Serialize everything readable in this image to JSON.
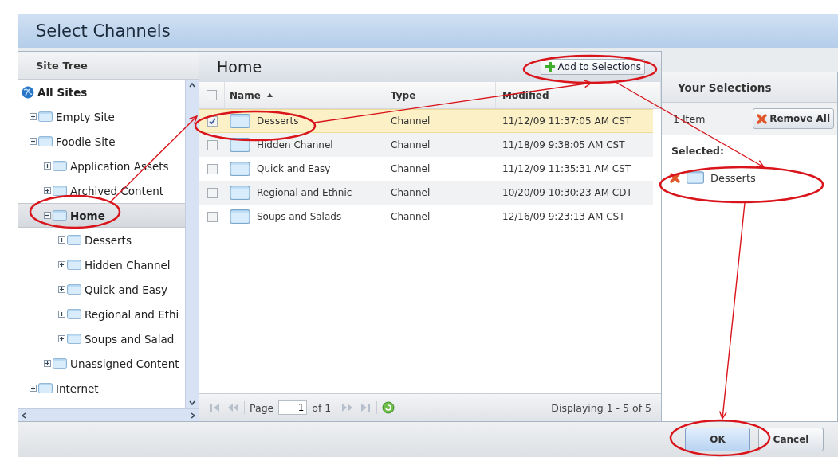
{
  "window": {
    "title": "Select Channels"
  },
  "site_tree": {
    "title": "Site Tree",
    "items": [
      {
        "label": "All Sites",
        "kind": "root",
        "selected": false,
        "children": [
          {
            "label": "Empty Site",
            "kind": "folder",
            "expanded": false,
            "selected": false
          },
          {
            "label": "Foodie Site",
            "kind": "folder",
            "expanded": true,
            "selected": false,
            "children": [
              {
                "label": "Application Assets",
                "kind": "folder",
                "expanded": false,
                "selected": false
              },
              {
                "label": "Archived Content",
                "kind": "folder",
                "expanded": false,
                "selected": false
              },
              {
                "label": "Home",
                "kind": "folder",
                "expanded": true,
                "selected": true,
                "children": [
                  {
                    "label": "Desserts",
                    "kind": "folder",
                    "expanded": false,
                    "selected": false
                  },
                  {
                    "label": "Hidden Channel",
                    "kind": "folder",
                    "expanded": false,
                    "selected": false
                  },
                  {
                    "label": "Quick and Easy",
                    "kind": "folder",
                    "expanded": false,
                    "selected": false
                  },
                  {
                    "label": "Regional and Ethi",
                    "kind": "folder",
                    "expanded": false,
                    "selected": false
                  },
                  {
                    "label": "Soups and Salad",
                    "kind": "folder",
                    "expanded": false,
                    "selected": false
                  }
                ]
              },
              {
                "label": "Unassigned Content",
                "kind": "folder",
                "expanded": false,
                "selected": false
              }
            ]
          },
          {
            "label": "Internet",
            "kind": "folder",
            "expanded": false,
            "selected": false
          }
        ]
      }
    ]
  },
  "channel_list": {
    "title": "Home",
    "add_button": "Add to Selections",
    "columns": [
      "Name",
      "Type",
      "Modified"
    ],
    "all_checked": false,
    "rows": [
      {
        "name": "Desserts",
        "type": "Channel",
        "modified": "11/12/09 11:37:05 AM CST",
        "checked": true,
        "selected": true
      },
      {
        "name": "Hidden Channel",
        "type": "Channel",
        "modified": "11/18/09 9:38:05 AM CST",
        "checked": false,
        "selected": false
      },
      {
        "name": "Quick and Easy",
        "type": "Channel",
        "modified": "11/12/09 11:35:31 AM CST",
        "checked": false,
        "selected": false
      },
      {
        "name": "Regional and Ethnic",
        "type": "Channel",
        "modified": "10/20/09 10:30:23 AM CDT",
        "checked": false,
        "selected": false
      },
      {
        "name": "Soups and Salads",
        "type": "Channel",
        "modified": "12/16/09 9:23:13 AM CST",
        "checked": false,
        "selected": false
      }
    ],
    "pager": {
      "page_label": "Page",
      "page": "1",
      "of": "of 1",
      "display": "Displaying 1 - 5 of 5"
    }
  },
  "selections": {
    "title": "Your Selections",
    "count": "1 Item",
    "remove_all": "Remove All",
    "selected_label": "Selected:",
    "items": [
      "Desserts"
    ]
  },
  "buttons": [
    "OK",
    "Cancel"
  ]
}
